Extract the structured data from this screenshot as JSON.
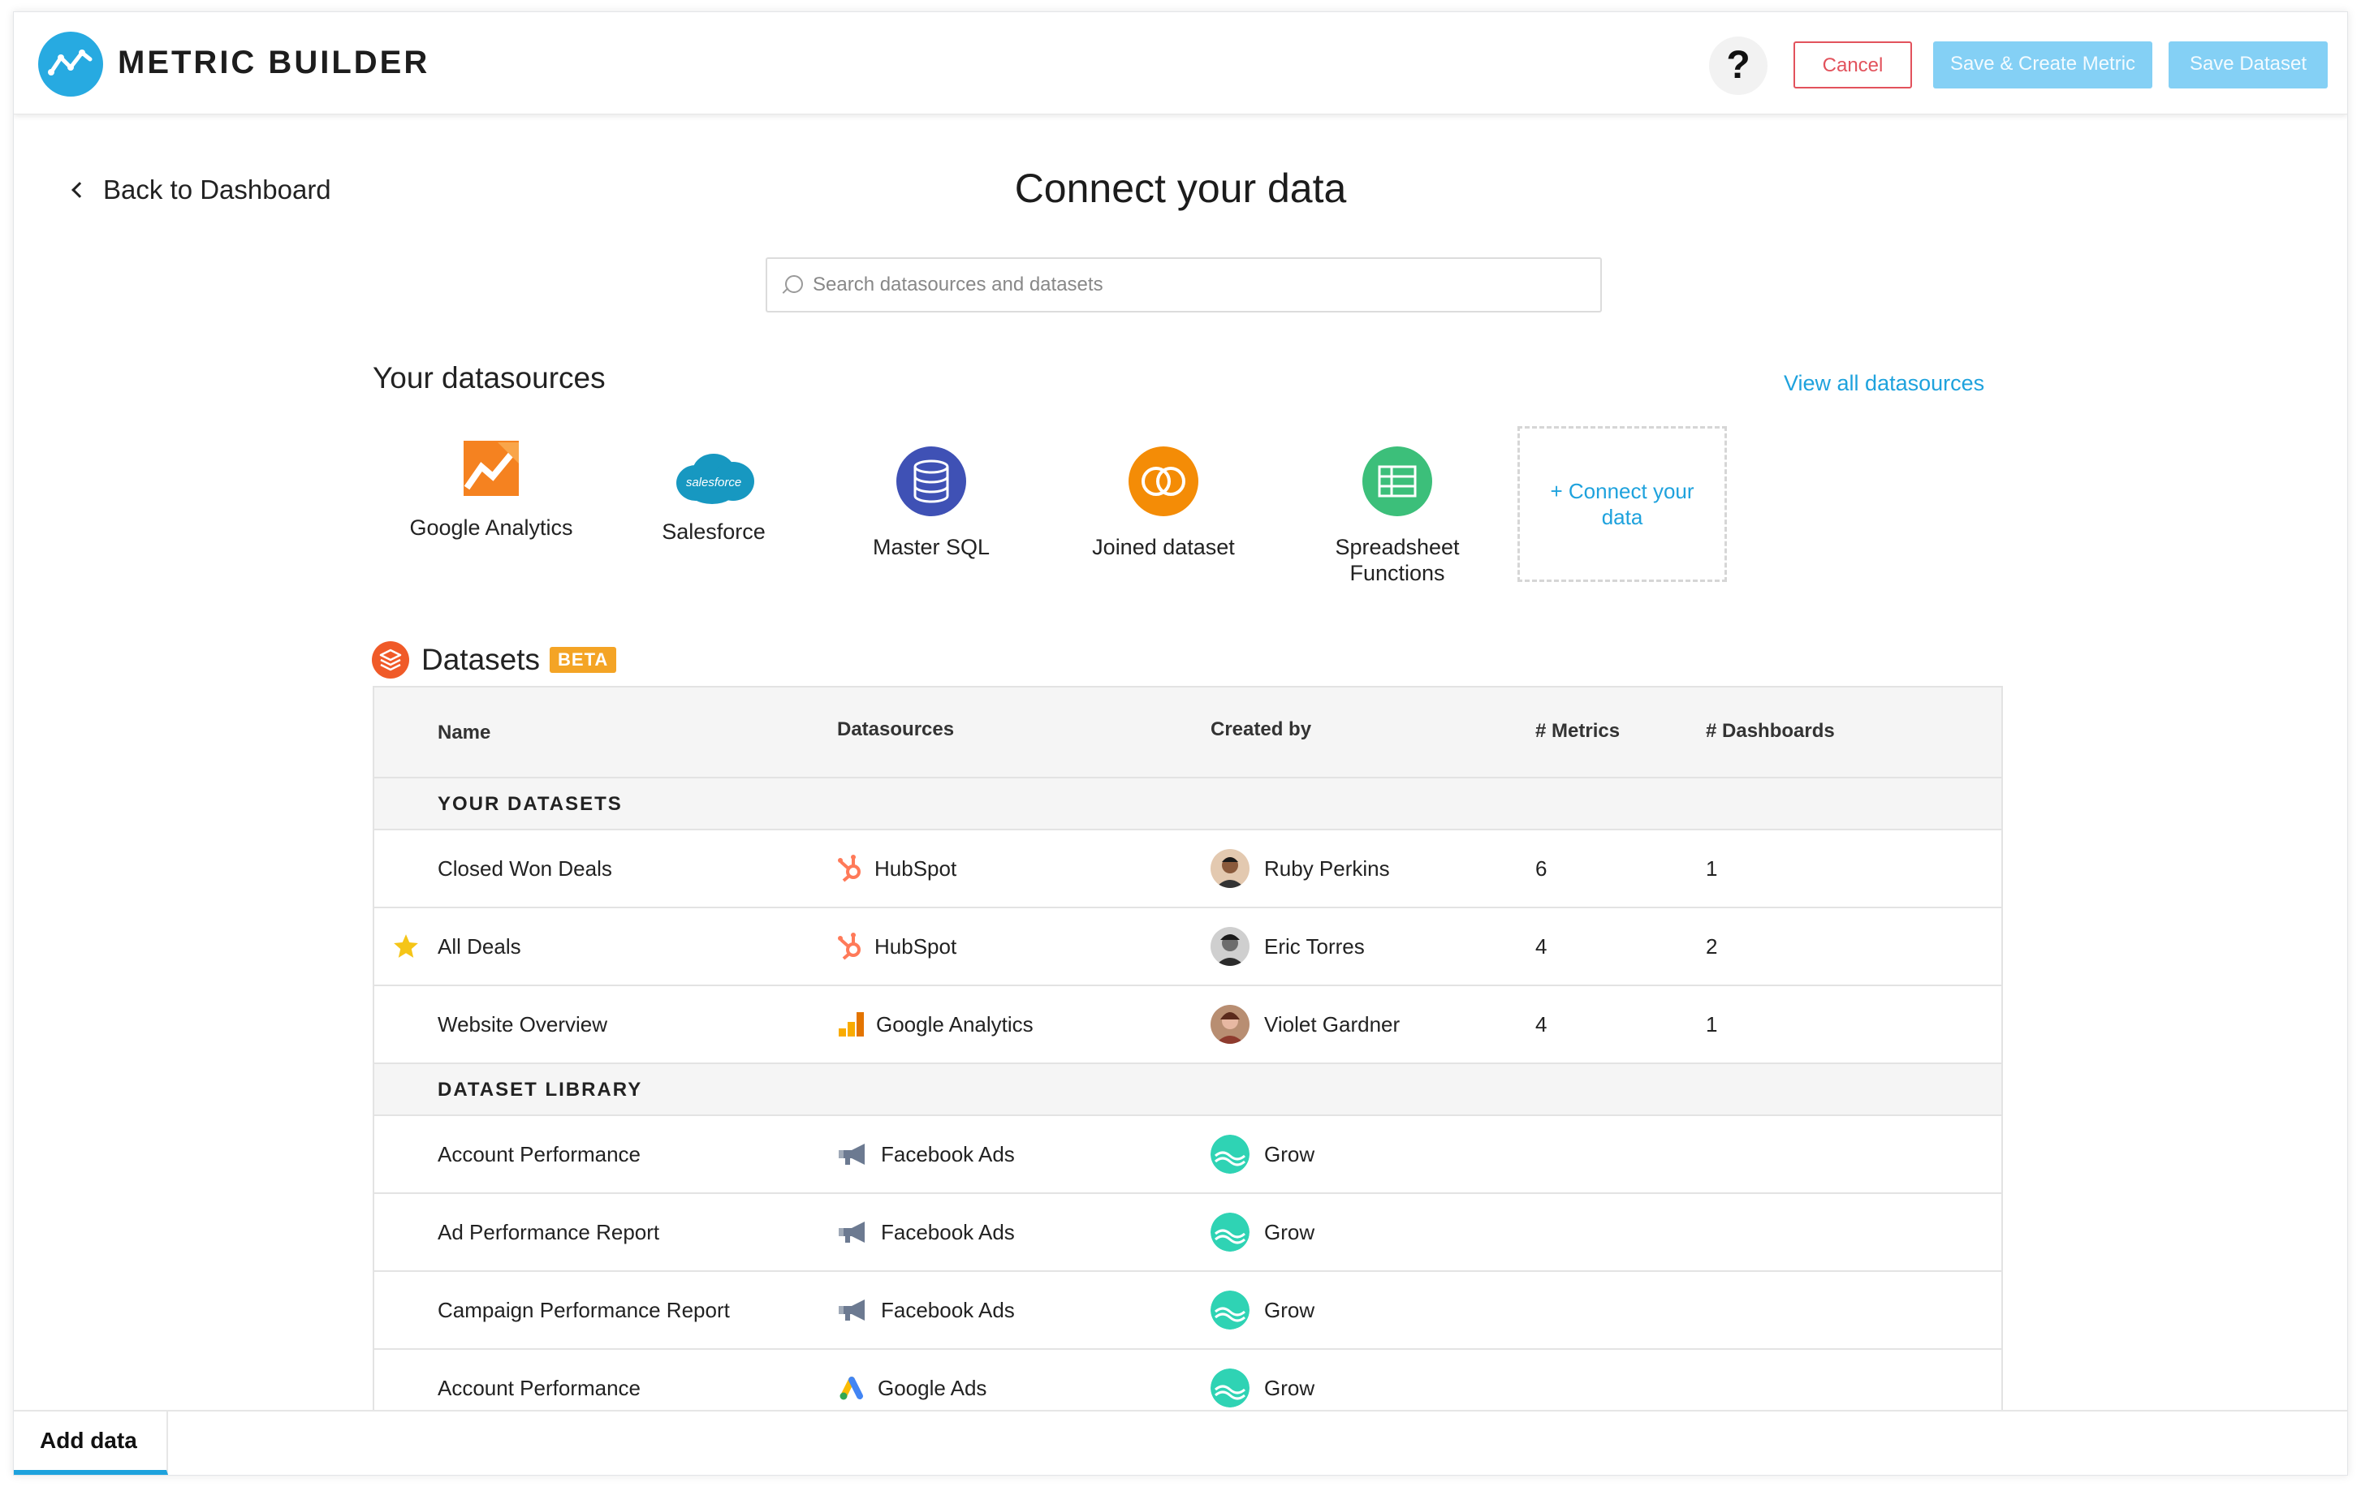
{
  "app": {
    "brand": "METRIC BUILDER"
  },
  "header": {
    "help_label": "?",
    "cancel_label": "Cancel",
    "save_create_label": "Save & Create Metric",
    "save_dataset_label": "Save Dataset",
    "colors": {
      "accent": "#1ea2dd",
      "cancel": "#e2525c",
      "disabled_button": "#84d0f5"
    }
  },
  "nav": {
    "back_label": "Back to Dashboard"
  },
  "page": {
    "title": "Connect your data"
  },
  "search": {
    "placeholder": "Search datasources and datasets",
    "value": ""
  },
  "datasources": {
    "title": "Your datasources",
    "view_all": "View all datasources",
    "items": [
      {
        "label": "Google Analytics",
        "icon": "google-analytics-icon"
      },
      {
        "label": "Salesforce",
        "icon": "salesforce-icon",
        "logo_text": "salesforce"
      },
      {
        "label": "Master SQL",
        "icon": "database-icon"
      },
      {
        "label": "Joined dataset",
        "icon": "joined-dataset-icon"
      },
      {
        "label": "Spreadsheet",
        "label2": "Functions",
        "icon": "spreadsheet-icon"
      }
    ],
    "connect": {
      "line1": "+ Connect your",
      "line2": "data"
    }
  },
  "datasets": {
    "title": "Datasets",
    "badge": "BETA",
    "columns": {
      "name": "Name",
      "datasources": "Datasources",
      "created_by": "Created by",
      "metrics": "# Metrics",
      "dashboards": "# Dashboards"
    },
    "groups": [
      {
        "label": "YOUR DATASETS"
      },
      {
        "label": "DATASET LIBRARY"
      }
    ],
    "rows": [
      {
        "name": "Closed Won Deals",
        "source": "HubSpot",
        "source_icon": "hubspot-icon",
        "created_by": "Ruby Perkins",
        "metrics": "6",
        "dashboards": "1",
        "starred": false
      },
      {
        "name": "All Deals",
        "source": "HubSpot",
        "source_icon": "hubspot-icon",
        "created_by": "Eric Torres",
        "metrics": "4",
        "dashboards": "2",
        "starred": true
      },
      {
        "name": "Website Overview",
        "source": "Google Analytics",
        "source_icon": "google-analytics-icon",
        "created_by": "Violet Gardner",
        "metrics": "4",
        "dashboards": "1",
        "starred": false
      },
      {
        "name": "Account Performance",
        "source": "Facebook Ads",
        "source_icon": "megaphone-icon",
        "created_by": "Grow",
        "metrics": "",
        "dashboards": ""
      },
      {
        "name": "Ad Performance Report",
        "source": "Facebook Ads",
        "source_icon": "megaphone-icon",
        "created_by": "Grow",
        "metrics": "",
        "dashboards": ""
      },
      {
        "name": "Campaign Performance Report",
        "source": "Facebook Ads",
        "source_icon": "megaphone-icon",
        "created_by": "Grow",
        "metrics": "",
        "dashboards": ""
      },
      {
        "name": "Account Performance",
        "source": "Google Ads",
        "source_icon": "google-ads-icon",
        "created_by": "Grow",
        "metrics": "",
        "dashboards": ""
      }
    ]
  },
  "tabs": {
    "active": "Add data"
  }
}
